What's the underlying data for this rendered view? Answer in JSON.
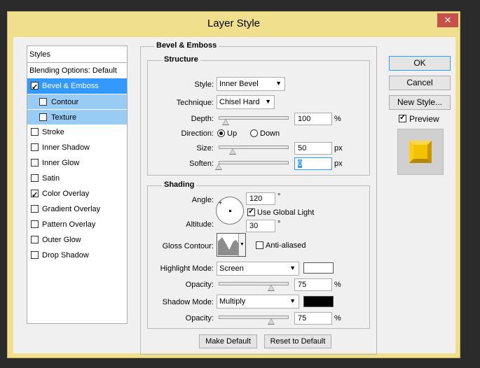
{
  "window": {
    "title": "Layer Style",
    "close_glyph": "✕"
  },
  "styles_list": {
    "header": "Styles",
    "blending": "Blending Options: Default",
    "items": [
      {
        "label": "Bevel & Emboss",
        "checked": true
      },
      {
        "label": "Contour",
        "checked": false
      },
      {
        "label": "Texture",
        "checked": false
      },
      {
        "label": "Stroke",
        "checked": false
      },
      {
        "label": "Inner Shadow",
        "checked": false
      },
      {
        "label": "Inner Glow",
        "checked": false
      },
      {
        "label": "Satin",
        "checked": false
      },
      {
        "label": "Color Overlay",
        "checked": true
      },
      {
        "label": "Gradient Overlay",
        "checked": false
      },
      {
        "label": "Pattern Overlay",
        "checked": false
      },
      {
        "label": "Outer Glow",
        "checked": false
      },
      {
        "label": "Drop Shadow",
        "checked": false
      }
    ]
  },
  "panel": {
    "title": "Bevel & Emboss",
    "structure": {
      "title": "Structure",
      "style_label": "Style:",
      "style_value": "Inner Bevel",
      "technique_label": "Technique:",
      "technique_value": "Chisel Hard",
      "depth_label": "Depth:",
      "depth_value": "100",
      "depth_unit": "%",
      "depth_level": 0.1,
      "direction_label": "Direction:",
      "direction_up": "Up",
      "direction_down": "Down",
      "size_label": "Size:",
      "size_value": "50",
      "size_unit": "px",
      "size_level": 0.2,
      "soften_label": "Soften:",
      "soften_value": "0",
      "soften_unit": "px",
      "soften_level": 0.0
    },
    "shading": {
      "title": "Shading",
      "angle_label": "Angle:",
      "angle_value": "120",
      "degree": "°",
      "global_light_label": "Use Global Light",
      "altitude_label": "Altitude:",
      "altitude_value": "30",
      "gloss_label": "Gloss Contour:",
      "anti_aliased_label": "Anti-aliased",
      "highlight_label": "Highlight Mode:",
      "highlight_value": "Screen",
      "highlight_color": "#ffffff",
      "highlight_opacity_label": "Opacity:",
      "highlight_opacity_value": "75",
      "highlight_opacity_level": 0.75,
      "shadow_label": "Shadow Mode:",
      "shadow_value": "Multiply",
      "shadow_color": "#000000",
      "shadow_opacity_label": "Opacity:",
      "shadow_opacity_value": "75",
      "shadow_opacity_level": 0.75,
      "percent": "%"
    },
    "make_default": "Make Default",
    "reset_default": "Reset to Default"
  },
  "actions": {
    "ok": "OK",
    "cancel": "Cancel",
    "new_style": "New Style...",
    "preview_label": "Preview",
    "preview_checked": true
  },
  "colors": {
    "accent": "#3399ff",
    "preview_fill": "#f5c200"
  }
}
